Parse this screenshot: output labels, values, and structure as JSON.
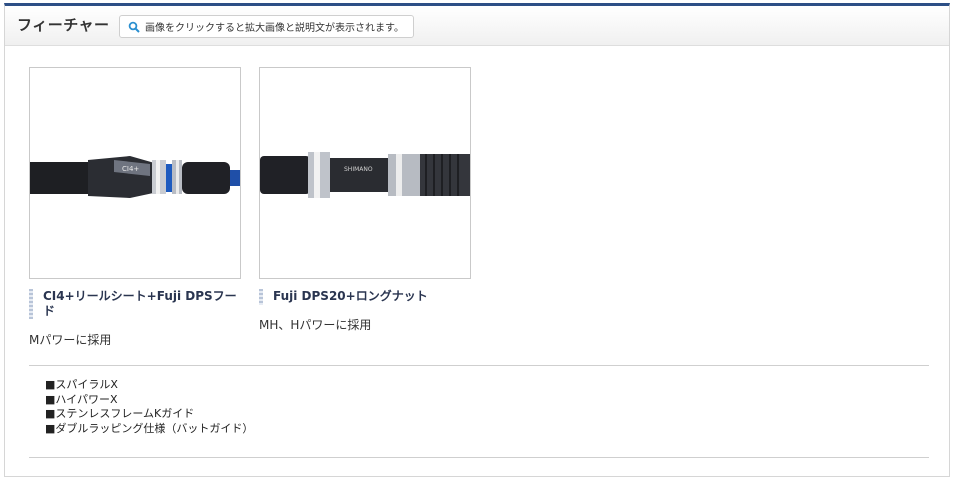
{
  "header": {
    "title": "フィーチャー",
    "hint": "画像をクリックすると拡大画像と説明文が表示されます。"
  },
  "cards": [
    {
      "caption": "CI4+リールシート+Fuji DPSフード",
      "description": "Mパワーに採用",
      "image_label": "CI4+"
    },
    {
      "caption": "Fuji DPS20+ロングナット",
      "description": "MH、Hパワーに採用",
      "image_label": "SHIMANO"
    }
  ],
  "features": [
    "■スパイラルX",
    "■ハイパワーX",
    "■ステンレスフレームKガイド",
    "■ダブルラッピング仕様（バットガイド）"
  ]
}
